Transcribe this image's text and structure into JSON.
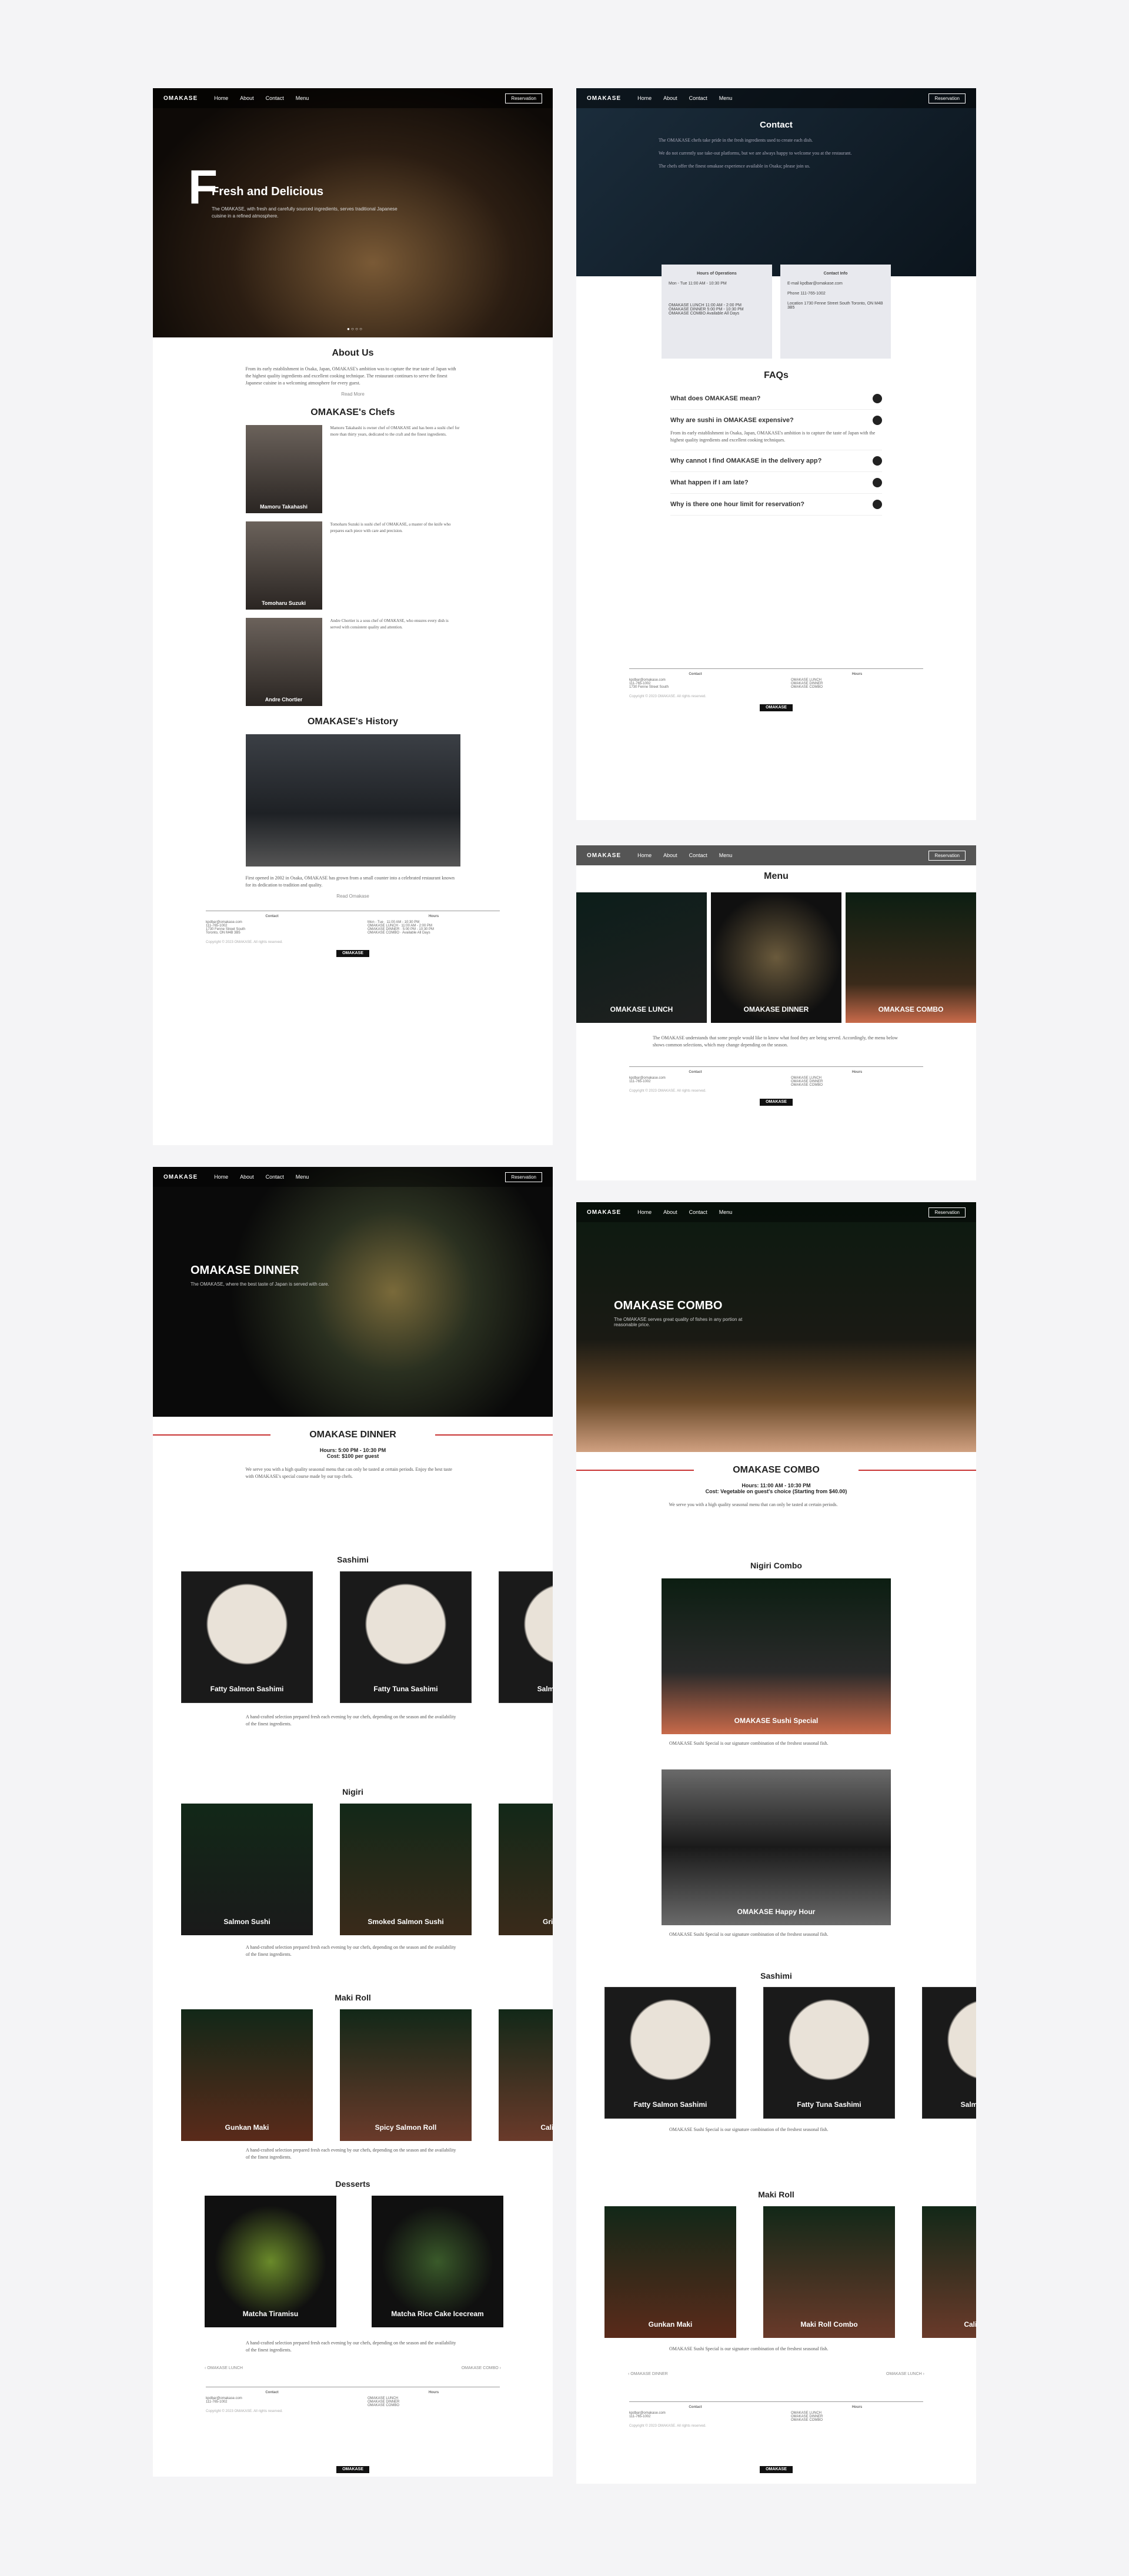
{
  "nav": {
    "logo": "OMAKASE",
    "links": [
      "Home",
      "About",
      "Contact",
      "Menu"
    ],
    "reservation": "Reservation"
  },
  "home": {
    "hero_title": "Fresh and Delicious",
    "hero_sub": "The OMAKASE, with fresh and carefully sourced ingredients, serves traditional Japanese cuisine in a refined atmosphere.",
    "about_title": "About Us",
    "about_text": "From its early establishment in Osaka, Japan, OMAKASE's ambition was to capture the true taste of Japan with the highest quality ingredients and excellent cooking technique. The restaurant continues to serve the finest Japanese cuisine in a welcoming atmosphere for every guest.",
    "read_more": "Read More",
    "chefs_title": "OMAKASE's Chefs",
    "chefs": [
      {
        "name": "Mamoru Takahashi",
        "bio": "Mamoru Takahashi is owner chef of OMAKASE and has been a sushi chef for more than thirty years, dedicated to the craft and the finest ingredients."
      },
      {
        "name": "Tomoharu Suzuki",
        "bio": "Tomoharu Suzuki is sushi chef of OMAKASE, a master of the knife who prepares each piece with care and precision."
      },
      {
        "name": "Andre Chortier",
        "bio": "Andre Chortier is a sous chef of OMAKASE, who ensures every dish is served with consistent quality and attention."
      }
    ],
    "history_title": "OMAKASE's History",
    "history_text": "First opened in 2002 in Osaka, OMAKASE has grown from a small counter into a celebrated restaurant known for its dedication to tradition and quality.",
    "more": "Read Omakase"
  },
  "footer": {
    "contact": "Contact",
    "email": "kpdbar@omakase.com",
    "phone": "111-765-1002",
    "addr1": "1730 Fenne Street South",
    "addr2": "Toronto, ON M4B 3B5",
    "hours": "Hours",
    "open": "Open",
    "closed": "Closed",
    "r1a": "Mon - Tue",
    "r1b": "11:00 AM - 10:30 PM",
    "r2a": "OMAKASE LUNCH",
    "r2b": "11:00 AM - 2:00 PM",
    "r3a": "OMAKASE DINNER",
    "r3b": "5:00 PM - 10:30 PM",
    "r4a": "OMAKASE COMBO",
    "r4b": "Available All Days",
    "copyright": "Copyright © 2023 OMAKASE. All rights reserved."
  },
  "contact": {
    "title": "Contact",
    "text1": "The OMAKASE chefs take pride in the fresh ingredients used to create each dish.",
    "text2": "We do not currently use take-out platforms, but we are always happy to welcome you at the restaurant.",
    "text3": "The chefs offer the finest omakase experience available in Osaka; please join us.",
    "hours_title": "Hours of Operations",
    "info_title": "Contact Info",
    "email_label": "E-mail",
    "email": "kpdbar@omakase.com",
    "phone_label": "Phone",
    "phone": "111-765-1002",
    "loc_label": "Location",
    "loc": "1730 Fenne Street South Toronto, ON M4B 3B5",
    "faq_title": "FAQs",
    "faqs": [
      "What does OMAKASE mean?",
      "Why are sushi in OMAKASE expensive?",
      "Why cannot I find OMAKASE in the delivery app?",
      "What happen if I am late?",
      "Why is there one hour limit for reservation?"
    ],
    "faq_answer": "From its early establishment in Osaka, Japan, OMAKASE's ambition is to capture the taste of Japan with the highest quality ingredients and excellent cooking techniques."
  },
  "menu": {
    "title": "Menu",
    "tiles": [
      "OMAKASE LUNCH",
      "OMAKASE DINNER",
      "OMAKASE COMBO"
    ],
    "text": "The OMAKASE understands that some people would like to know what food they are being served. Accordingly, the menu below shows common selections, which may change depending on the season."
  },
  "dinner": {
    "hero": "OMAKASE DINNER",
    "hero_sub": "The OMAKASE, where the best taste of Japan is served with care.",
    "title": "OMAKASE DINNER",
    "hours": "Hours: 5:00 PM - 10:30 PM",
    "cost": "Cost: $100 per guest",
    "intro": "We serve you with a high quality seasonal menu that can only be tasted at certain periods. Enjoy the best taste with OMAKASE's special course made by our top chefs.",
    "sashimi": "Sashimi",
    "sashimi_items": [
      "Fatty Salmon Sashimi",
      "Fatty Tuna Sashimi",
      "Salmon Sashimi"
    ],
    "nigiri": "Nigiri",
    "nigiri_items": [
      "Salmon Sushi",
      "Smoked Salmon Sushi",
      "Grilled Sushi"
    ],
    "maki": "Maki Roll",
    "maki_items": [
      "Gunkan Maki",
      "Spicy Salmon Roll",
      "California Roll"
    ],
    "desserts": "Desserts",
    "dessert_items": [
      "Matcha Tiramisu",
      "Matcha Rice Cake Icecream"
    ],
    "prev": "OMAKASE LUNCH",
    "next": "OMAKASE COMBO",
    "para": "A hand-crafted selection prepared fresh each evening by our chefs, depending on the season and the availability of the finest ingredients."
  },
  "combo": {
    "hero": "OMAKASE COMBO",
    "hero_sub": "The OMAKASE serves great quality of fishes in any portion at reasonable price.",
    "title": "OMAKASE COMBO",
    "hours": "Hours: 11:00 AM - 10:30 PM",
    "cost": "Cost: Vegetable on guest's choice (Starting from $40.00)",
    "intro": "We serve you with a high quality seasonal menu that can only be tasted at certain periods.",
    "nigiri": "Nigiri Combo",
    "nigiri_items": [
      "OMAKASE Sushi Special",
      "OMAKASE Happy Hour"
    ],
    "sashimi": "Sashimi",
    "sashimi_items": [
      "Fatty Salmon Sashimi",
      "Fatty Tuna Sashimi",
      "Salmon Sashimi"
    ],
    "maki": "Maki Roll",
    "maki_items": [
      "Gunkan Maki",
      "Maki Roll Combo",
      "California Roll"
    ],
    "prev": "OMAKASE DINNER",
    "next": "OMAKASE LUNCH",
    "para": "OMAKASE Sushi Special is our signature combination of the freshest seasonal fish."
  }
}
